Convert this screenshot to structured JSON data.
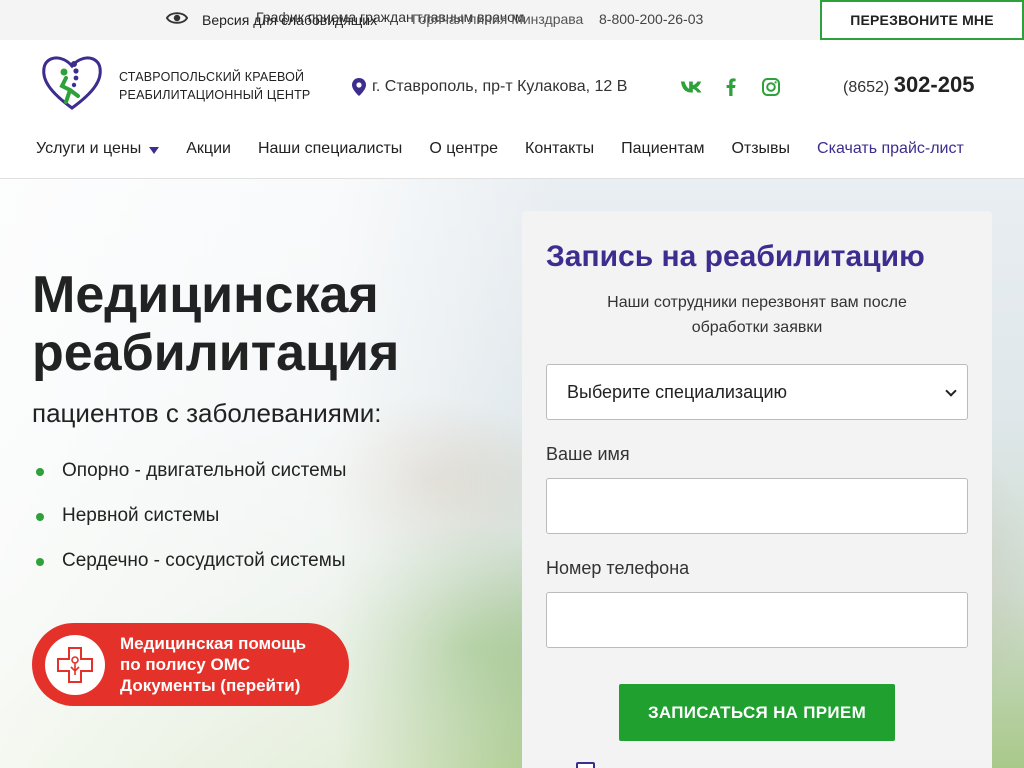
{
  "topbar": {
    "a11y_label": "Версия для слабовидящих",
    "schedule_label": "График приема граждан главным врачом",
    "hotline_label": "Горячая линия Минздрава",
    "hotline_phone": "8-800-200-26-03",
    "callback_button": "ПЕРЕЗВОНИТЕ МНЕ"
  },
  "header": {
    "org_line1": "СТАВРОПОЛЬСКИЙ КРАЕВОЙ",
    "org_line2": "РЕАБИЛИТАЦИОННЫЙ ЦЕНТР",
    "address": "г. Ставрополь, пр-т Кулакова, 12 В",
    "socials": [
      "vk-icon",
      "facebook-icon",
      "instagram-icon"
    ],
    "phone_code": "(8652)",
    "phone_number": "302-205"
  },
  "nav": {
    "items": [
      "Услуги и цены",
      "Акции",
      "Наши специалисты",
      "О центре",
      "Контакты",
      "Пациентам",
      "Отзывы"
    ],
    "price_link": "Скачать прайс-лист"
  },
  "hero": {
    "title_line1": "Медицинская",
    "title_line2": "реабилитация",
    "subtitle": "пациентов с заболеваниями:",
    "list": [
      "Опорно - двигательной системы",
      "Нервной системы",
      "Сердечно - сосудистой системы"
    ],
    "oms_line1": "Медицинская помощь",
    "oms_line2": "по полису ОМС",
    "oms_line3": "Документы (перейти)"
  },
  "form": {
    "title": "Запись на реабилитацию",
    "subtitle_line1": "Наши сотрудники перезвонят вам после",
    "subtitle_line2": "обработки заявки",
    "select_value": "Выберите специализацию",
    "name_label": "Ваше имя",
    "name_value": "",
    "phone_label": "Номер телефона",
    "phone_value": "",
    "submit": "ЗАПИСАТЬСЯ НА ПРИЕМ"
  },
  "colors": {
    "brand_purple": "#3d2d8f",
    "brand_green": "#1fa02f",
    "accent_red": "#e4322b"
  }
}
